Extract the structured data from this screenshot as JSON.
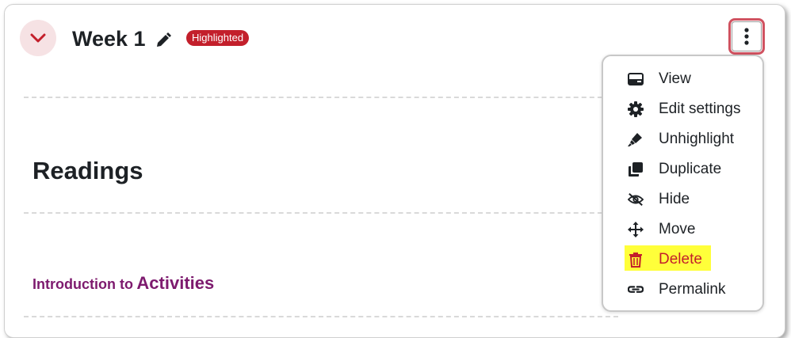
{
  "section": {
    "title": "Week 1",
    "badge": "Highlighted"
  },
  "content": {
    "heading": "Readings",
    "activity_prefix": "Introduction to",
    "activity_name": "Activities"
  },
  "menu": {
    "items": [
      {
        "label": "View",
        "icon": "view-icon"
      },
      {
        "label": "Edit settings",
        "icon": "gear-icon"
      },
      {
        "label": "Unhighlight",
        "icon": "highlighter-icon"
      },
      {
        "label": "Duplicate",
        "icon": "duplicate-icon"
      },
      {
        "label": "Hide",
        "icon": "eye-slash-icon"
      },
      {
        "label": "Move",
        "icon": "move-icon"
      },
      {
        "label": "Delete",
        "icon": "trash-icon"
      },
      {
        "label": "Permalink",
        "icon": "link-icon"
      }
    ]
  },
  "colors": {
    "badge": "#c31f2b",
    "activity_link": "#7d1a6e",
    "delete": "#c31f2b",
    "highlight": "#ffff3a",
    "kebab_border": "#d05260"
  }
}
